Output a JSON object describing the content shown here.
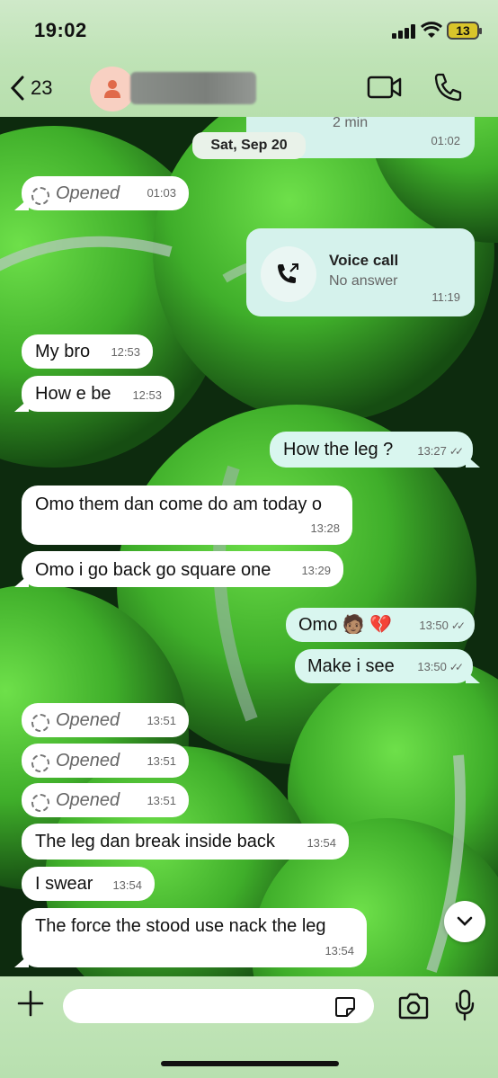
{
  "status": {
    "time": "19:02",
    "battery": "13"
  },
  "header": {
    "back_count": "23"
  },
  "date_chip": "Sat, Sep 20",
  "top_call": {
    "sub": "2 min",
    "time": "01:02"
  },
  "call_card": {
    "title": "Voice call",
    "sub": "No answer",
    "time": "11:19"
  },
  "messages": [
    {
      "text": "Opened",
      "time": "01:03"
    },
    {
      "text": "My bro",
      "time": "12:53"
    },
    {
      "text": "How e be",
      "time": "12:53"
    },
    {
      "text": "How the leg ?",
      "time": "13:27"
    },
    {
      "text": "Omo them dan come do am today o",
      "time": "13:28"
    },
    {
      "text": "Omo i go back go square one",
      "time": "13:29"
    },
    {
      "text": "Omo 🧑🏽 💔",
      "time": "13:50"
    },
    {
      "text": "Make i see",
      "time": "13:50"
    },
    {
      "text": "Opened",
      "time": "13:51"
    },
    {
      "text": "Opened",
      "time": "13:51"
    },
    {
      "text": "Opened",
      "time": "13:51"
    },
    {
      "text": "The leg dan break inside back",
      "time": "13:54"
    },
    {
      "text": "I swear",
      "time": "13:54"
    },
    {
      "text": "The force the stood use nack the  leg",
      "time": "13:54"
    }
  ],
  "composer": {
    "placeholder": ""
  },
  "colors": {
    "incoming": "#ffffff",
    "outgoing": "#d9f6ef",
    "wallpaper": "#3fae2a"
  },
  "icons": [
    "back-chevron-icon",
    "contact-avatar-icon",
    "video-call-icon",
    "phone-icon",
    "outgoing-call-icon",
    "chevron-down-icon",
    "plus-icon",
    "sticker-icon",
    "camera-icon",
    "microphone-icon"
  ]
}
